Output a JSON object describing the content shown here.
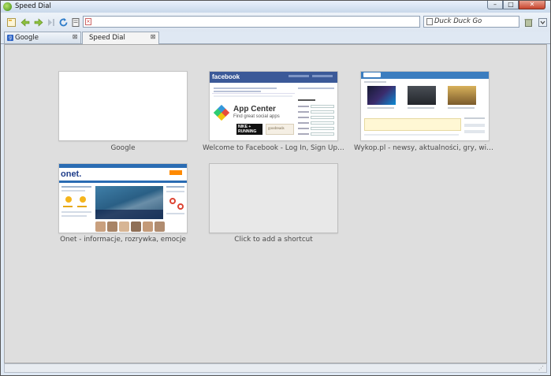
{
  "window": {
    "title": "Speed Dial"
  },
  "window_controls": {
    "minimize": "–",
    "maximize": "□",
    "close": "✕"
  },
  "toolbar": {
    "icons": [
      "new-page-icon",
      "back-icon",
      "forward-icon",
      "stop-icon",
      "reload-icon",
      "page-info-icon"
    ],
    "url_value": "",
    "search": {
      "placeholder": "Duck Duck Go"
    }
  },
  "tabs": [
    {
      "label": "Google",
      "favicon": "g",
      "active": false
    },
    {
      "label": "Speed Dial",
      "active": true
    }
  ],
  "speed_dial": [
    {
      "caption": "Google"
    },
    {
      "caption": "Welcome to Facebook - Log In, Sign Up or L..."
    },
    {
      "caption": "Wykop.pl - newsy, aktualności, gry, wiadom..."
    },
    {
      "caption": "Onet - informacje, rozrywka, emocje"
    },
    {
      "caption": "Click to add a shortcut"
    }
  ],
  "thumbnails": {
    "facebook": {
      "logo": "facebook",
      "app_title": "App Center",
      "app_sub": "Find great social apps",
      "nike": "NIKE +\nRUNNING",
      "goodreads": "goodreads"
    },
    "onet": {
      "logo": "onet."
    }
  },
  "colors": {
    "accent": "#3b5998",
    "content_bg": "#dedede"
  }
}
